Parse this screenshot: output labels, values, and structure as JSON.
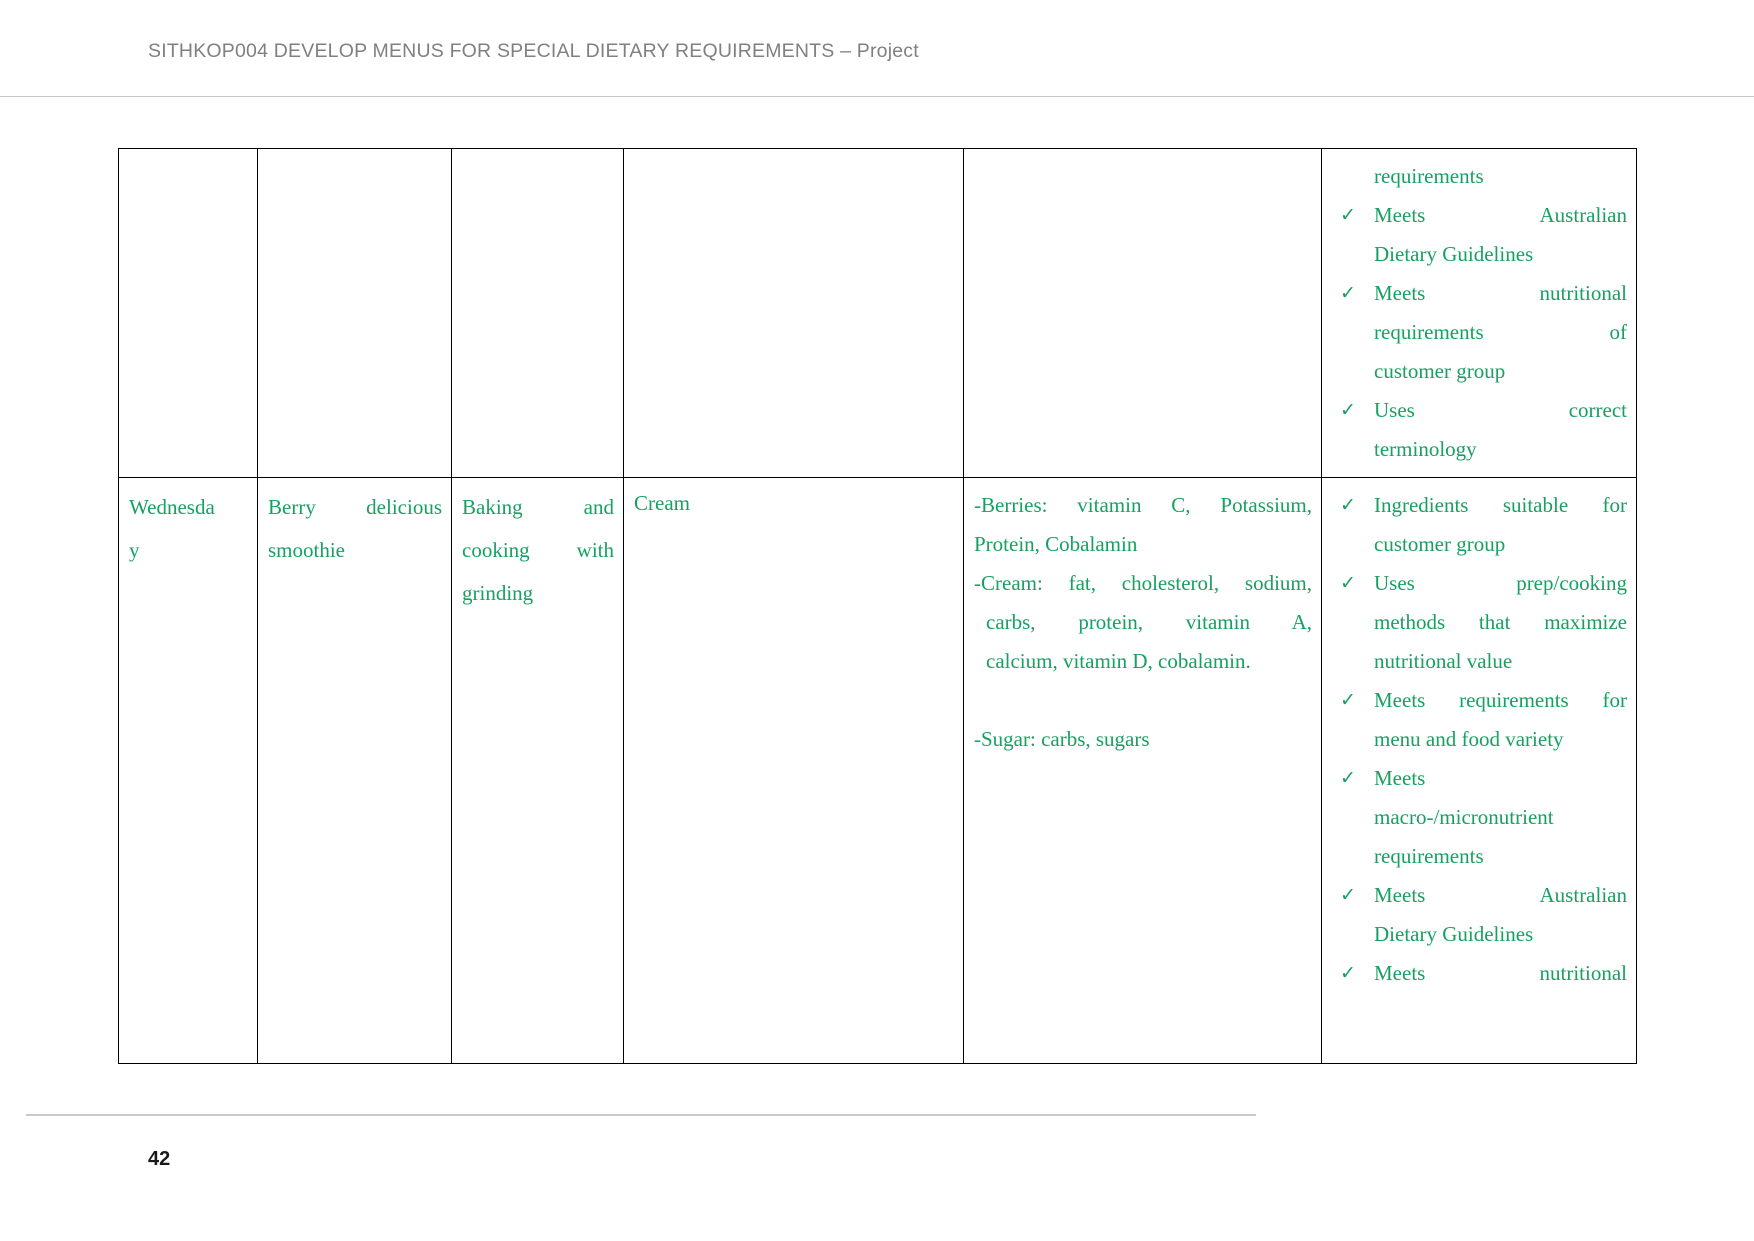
{
  "header": {
    "title": "SITHKOP004 DEVELOP MENUS FOR SPECIAL DIETARY REQUIREMENTS – Project"
  },
  "footer": {
    "page_number": "42"
  },
  "colors": {
    "text_green": "#17a061",
    "header_grey": "#808080",
    "rule_grey": "#c9c9c9",
    "table_border": "#000000"
  },
  "icons": {
    "tick": "✓"
  },
  "table": {
    "rows": [
      {
        "day": "",
        "dish": "",
        "method": "",
        "ingredient": "",
        "nutrition": [],
        "criteria": {
          "continued_line": "requirements",
          "items": [
            {
              "text": "Meets Australian Dietary Guidelines",
              "lines": [
                "Meets Australian",
                "Dietary Guidelines"
              ]
            },
            {
              "text": "Meets nutritional requirements of customer group",
              "lines": [
                "Meets nutritional",
                "requirements of",
                "customer group"
              ]
            },
            {
              "text": "Uses correct terminology",
              "lines": [
                "Uses correct",
                "terminology"
              ]
            }
          ]
        }
      },
      {
        "day": "Wednesday",
        "day_lines": [
          "Wednesda",
          "y"
        ],
        "dish": "Berry delicious smoothie",
        "dish_lines": [
          "Berry delicious",
          "smoothie"
        ],
        "method": "Baking and cooking with grinding",
        "method_lines": [
          "Baking and",
          "cooking with",
          "grinding"
        ],
        "ingredient": "Cream",
        "nutrition": [
          {
            "lines": [
              "-Berries: vitamin C, Potassium,",
              "Protein, Cobalamin"
            ],
            "indent": false
          },
          {
            "lines": [
              "-Cream: fat, cholesterol, sodium,",
              "carbs, protein, vitamin A,",
              "calcium, vitamin D, cobalamin."
            ],
            "indent": true
          },
          {
            "lines": [
              "-Sugar: carbs, sugars"
            ],
            "indent": false
          }
        ],
        "criteria": {
          "continued_line": "",
          "items": [
            {
              "text": "Ingredients suitable for customer group",
              "lines": [
                "Ingredients suitable for",
                "customer group"
              ]
            },
            {
              "text": "Uses prep/cooking methods that maximize nutritional value",
              "lines": [
                "Uses prep/cooking",
                "methods that maximize",
                "nutritional value"
              ]
            },
            {
              "text": "Meets requirements for menu and food variety",
              "lines": [
                "Meets requirements for",
                "menu and food variety"
              ]
            },
            {
              "text": "Meets macro-/micronutrient requirements",
              "lines": [
                "Meets",
                "macro-/micronutrient",
                "requirements"
              ]
            },
            {
              "text": "Meets Australian Dietary Guidelines",
              "lines": [
                "Meets Australian",
                "Dietary Guidelines"
              ]
            },
            {
              "text": "Meets nutritional",
              "lines": [
                "Meets nutritional"
              ]
            }
          ]
        }
      }
    ]
  }
}
